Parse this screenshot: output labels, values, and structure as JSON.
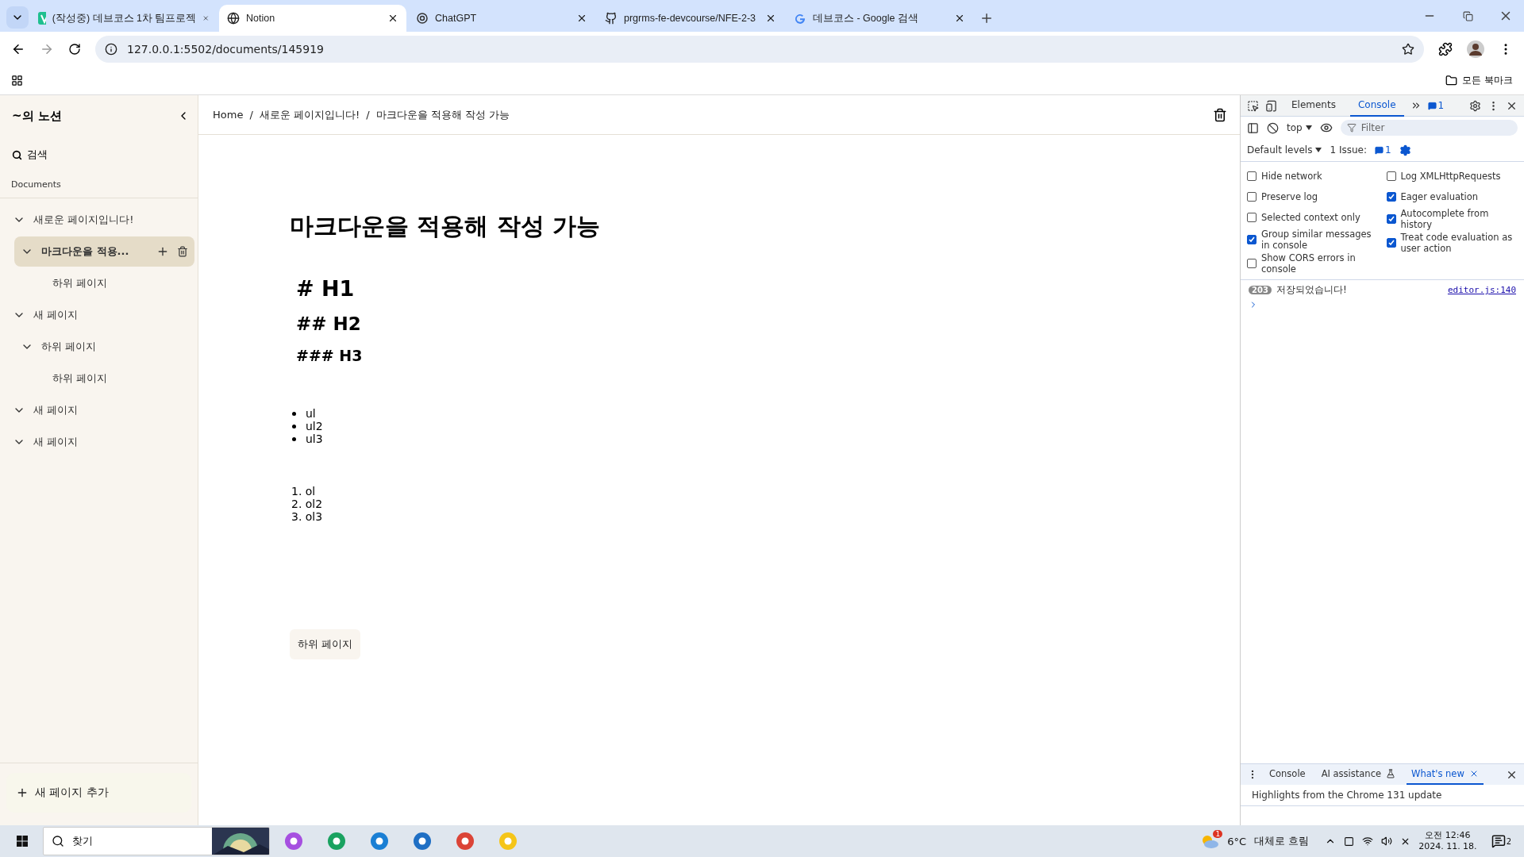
{
  "browser": {
    "tabs": [
      {
        "title": "(작성중) 데브코스 1차 팀프로젝",
        "selected": false
      },
      {
        "title": "Notion",
        "selected": true
      },
      {
        "title": "ChatGPT",
        "selected": false
      },
      {
        "title": "prgrms-fe-devcourse/NFE-2-3",
        "selected": false
      },
      {
        "title": "데브코스 - Google 검색",
        "selected": false
      }
    ],
    "url": "127.0.0.1:5502/documents/145919",
    "bookmarks_label": "모든 북마크"
  },
  "sidebar": {
    "title": "~의 노션",
    "search": "검색",
    "section": "Documents",
    "add_page": "새 페이지 추가",
    "items": [
      {
        "title": "새로운 페이지입니다!",
        "expanded": true,
        "selected": false,
        "children": [
          {
            "title": "마크다운을 적용...",
            "expanded": true,
            "selected": true,
            "children": [
              {
                "title": "하위 페이지",
                "selected": false
              }
            ]
          }
        ]
      },
      {
        "title": "새 페이지",
        "expanded": true,
        "selected": false,
        "children": [
          {
            "title": "하위 페이지",
            "expanded": true,
            "selected": false,
            "children": [
              {
                "title": "하위 페이지",
                "selected": false
              }
            ]
          }
        ]
      },
      {
        "title": "새 페이지",
        "expanded": true,
        "selected": false
      },
      {
        "title": "새 페이지",
        "expanded": true,
        "selected": false
      }
    ]
  },
  "editor": {
    "breadcrumb": [
      "Home",
      "새로운 페이지입니다!",
      "마크다운을 적용해 작성 가능"
    ],
    "breadcrumb_separator": "/",
    "title": "마크다운을 적용해 작성 가능",
    "blocks": [
      {
        "kind": "h1",
        "text": "# H1"
      },
      {
        "kind": "h2",
        "text": "## H2"
      },
      {
        "kind": "h3",
        "text": "### H3"
      },
      {
        "kind": "ul",
        "items": [
          "ul",
          "ul2",
          "ul3"
        ]
      },
      {
        "kind": "ol",
        "items": [
          "1.  ol",
          "2. ol2",
          "3. ol3"
        ]
      }
    ],
    "subpage_button": "하위 페이지"
  },
  "devtools": {
    "tabs": [
      {
        "label": "Elements",
        "selected": false
      },
      {
        "label": "Console",
        "selected": true
      }
    ],
    "message_badge": "1",
    "context": "top",
    "filter_placeholder": "Filter",
    "levels": "Default levels",
    "issues_label": "1 Issue:",
    "issues_count": "1",
    "settings": [
      {
        "label": "Hide network",
        "checked": false
      },
      {
        "label": "Preserve log",
        "checked": false
      },
      {
        "label": "Selected context only",
        "checked": false
      },
      {
        "label": "Group similar messages in console",
        "checked": true
      },
      {
        "label": "Show CORS errors in console",
        "checked": false
      },
      {
        "label": "Log XMLHttpRequests",
        "checked": false
      },
      {
        "label": "Eager evaluation",
        "checked": true
      },
      {
        "label": "Autocomplete from history",
        "checked": true
      },
      {
        "label": "Treat code evaluation as user action",
        "checked": true
      }
    ],
    "messages": [
      {
        "count": "203",
        "text": "저장되었습니다!",
        "source": "editor.js:140"
      }
    ],
    "drawer_tabs": [
      {
        "label": "Console",
        "selected": false
      },
      {
        "label": "AI assistance",
        "selected": false
      },
      {
        "label": "What's new",
        "selected": true
      }
    ],
    "drawer_text": "Highlights from the Chrome 131 update"
  },
  "taskbar": {
    "search": "찾기",
    "weather_badge": "1",
    "temperature": "6°C",
    "weather": "대체로 흐림",
    "time": "오전 12:46",
    "date": "2024. 11. 18.",
    "notifications": "2"
  }
}
